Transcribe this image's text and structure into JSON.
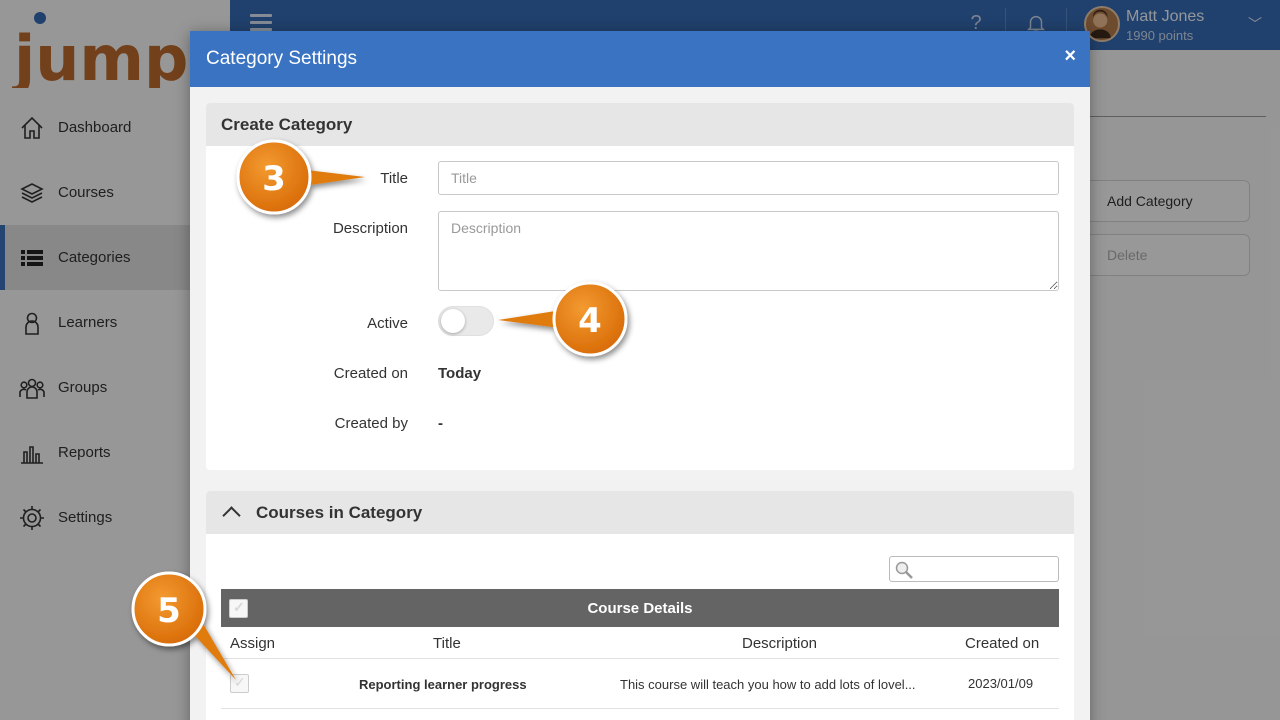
{
  "app": {
    "logo_text": "jumpIn",
    "nav": [
      {
        "label": "Dashboard",
        "icon": "home-icon"
      },
      {
        "label": "Courses",
        "icon": "courses-stack-icon"
      },
      {
        "label": "Categories",
        "icon": "list-icon",
        "active": true
      },
      {
        "label": "Learners",
        "icon": "person-icon"
      },
      {
        "label": "Groups",
        "icon": "group-icon"
      },
      {
        "label": "Reports",
        "icon": "bar-chart-icon"
      },
      {
        "label": "Settings",
        "icon": "gear-icon"
      }
    ],
    "topbar": {
      "help_icon": "question-icon",
      "bell_icon": "bell-icon",
      "user_name": "Matt Jones",
      "user_points": "1990 points"
    },
    "background_buttons": {
      "add_category": "Add Category",
      "delete": "Delete"
    }
  },
  "modal": {
    "title": "Category Settings",
    "close_label": "×",
    "create_section": {
      "heading": "Create Category",
      "title_label": "Title",
      "title_placeholder": "Title",
      "title_value": "",
      "description_label": "Description",
      "description_placeholder": "Description",
      "description_value": "",
      "active_label": "Active",
      "active": false,
      "created_on_label": "Created on",
      "created_on_value": "Today",
      "created_by_label": "Created by",
      "created_by_value": "-"
    },
    "courses_section": {
      "heading": "Courses in Category",
      "search_placeholder": "",
      "table_group_header": "Course Details",
      "columns": [
        "Assign",
        "Title",
        "Description",
        "Created on"
      ],
      "rows": [
        {
          "assigned": false,
          "title": "Reporting learner progress",
          "description": "This course will teach you how to add lots of lovel...",
          "created_on": "2023/01/09"
        }
      ]
    }
  },
  "callouts": [
    "3",
    "4",
    "5"
  ],
  "colors": {
    "topbar": "#3569b0",
    "modal_header": "#3a73c2",
    "callout_orange": "#e07b10",
    "table_header": "#646464"
  }
}
